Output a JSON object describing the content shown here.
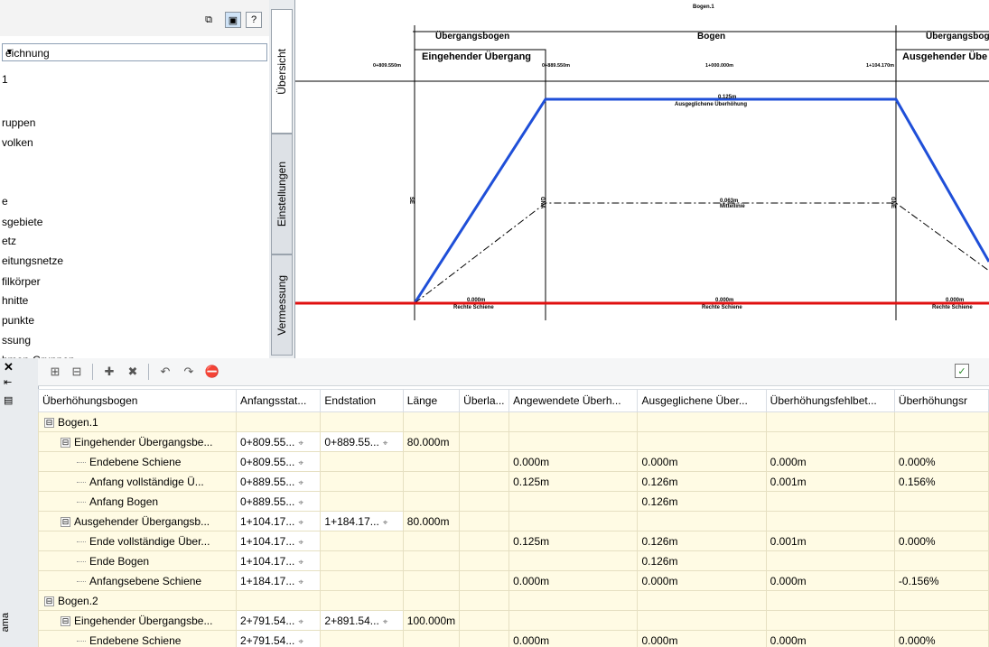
{
  "left_panel": {
    "combo_value": "eichnung",
    "items": [
      "1",
      "ruppen",
      "volken",
      "e",
      "sgebiete",
      "etz",
      "eitungsnetze",
      "filkörper",
      "hnitte",
      "punkte",
      "ssung",
      "hmen-Gruppen"
    ]
  },
  "vtabs": [
    "Übersicht",
    "Einstellungen",
    "Vermessung"
  ],
  "dock_label": "ama",
  "drawing": {
    "top_label": "Bogen.1",
    "sections": [
      "Übergangsbogen",
      "Bogen",
      "Übergangsbog"
    ],
    "sub_sections": [
      "Eingehender Übergang",
      "Ausgehender Übe"
    ],
    "stations": [
      "0+809.550m",
      "0+889.550m",
      "1+000.000m",
      "1+104.170m",
      "1+184.170m"
    ],
    "dim_top": "0.125m",
    "dim_top_label": "Ausgeglichene Überhöhung",
    "dim_mid": "0.063m",
    "dim_mid_label": "Mittellinie",
    "dim_rail": "0.000m",
    "rail_label": "Rechte Schiene",
    "marks": [
      "SE",
      "GNA",
      "GNE"
    ]
  },
  "table": {
    "columns": [
      "Überhöhungsbogen",
      "Anfangsstat...",
      "Endstation",
      "Länge",
      "Überla...",
      "Angewendete Überh...",
      "Ausgeglichene Über...",
      "Überhöhungsfehlbet...",
      "Überhöhungsr"
    ],
    "rows": [
      {
        "level": 0,
        "expander": "⊟",
        "name": "Bogen.1",
        "start": "",
        "end": "",
        "len": "",
        "ov": "",
        "applied": "",
        "comp": "",
        "def": "",
        "rate": ""
      },
      {
        "level": 1,
        "expander": "⊟",
        "name": "Eingehender Übergangsbe...",
        "start": "0+809.55...",
        "end": "0+889.55...",
        "len": "80.000m",
        "ov": "",
        "applied": "",
        "comp": "",
        "def": "",
        "rate": ""
      },
      {
        "level": 2,
        "expander": "",
        "name": "Endebene Schiene",
        "start": "0+809.55...",
        "end": "",
        "len": "",
        "ov": "",
        "applied": "0.000m",
        "comp": "0.000m",
        "def": "0.000m",
        "rate": "0.000%"
      },
      {
        "level": 2,
        "expander": "",
        "name": "Anfang vollständige Ü...",
        "start": "0+889.55...",
        "end": "",
        "len": "",
        "ov": "",
        "applied": "0.125m",
        "comp": "0.126m",
        "def": "0.001m",
        "rate": "0.156%"
      },
      {
        "level": 2,
        "expander": "",
        "name": "Anfang Bogen",
        "start": "0+889.55...",
        "end": "",
        "len": "",
        "ov": "",
        "applied": "",
        "comp": "0.126m",
        "def": "",
        "rate": ""
      },
      {
        "level": 1,
        "expander": "⊟",
        "name": "Ausgehender Übergangsb...",
        "start": "1+104.17...",
        "end": "1+184.17...",
        "len": "80.000m",
        "ov": "",
        "applied": "",
        "comp": "",
        "def": "",
        "rate": ""
      },
      {
        "level": 2,
        "expander": "",
        "name": "Ende vollständige Über...",
        "start": "1+104.17...",
        "end": "",
        "len": "",
        "ov": "",
        "applied": "0.125m",
        "comp": "0.126m",
        "def": "0.001m",
        "rate": "0.000%"
      },
      {
        "level": 2,
        "expander": "",
        "name": "Ende Bogen",
        "start": "1+104.17...",
        "end": "",
        "len": "",
        "ov": "",
        "applied": "",
        "comp": "0.126m",
        "def": "",
        "rate": ""
      },
      {
        "level": 2,
        "expander": "",
        "name": "Anfangsebene Schiene",
        "start": "1+184.17...",
        "end": "",
        "len": "",
        "ov": "",
        "applied": "0.000m",
        "comp": "0.000m",
        "def": "0.000m",
        "rate": "-0.156%"
      },
      {
        "level": 0,
        "expander": "⊟",
        "name": "Bogen.2",
        "start": "",
        "end": "",
        "len": "",
        "ov": "",
        "applied": "",
        "comp": "",
        "def": "",
        "rate": ""
      },
      {
        "level": 1,
        "expander": "⊟",
        "name": "Eingehender Übergangsbe...",
        "start": "2+791.54...",
        "end": "2+891.54...",
        "len": "100.000m",
        "ov": "",
        "applied": "",
        "comp": "",
        "def": "",
        "rate": ""
      },
      {
        "level": 2,
        "expander": "",
        "name": "Endebene Schiene",
        "start": "2+791.54...",
        "end": "",
        "len": "",
        "ov": "",
        "applied": "0.000m",
        "comp": "0.000m",
        "def": "0.000m",
        "rate": "0.000%"
      }
    ]
  },
  "colors": {
    "superelevation_line": "#1f4fd8",
    "rail_line": "#e01010"
  }
}
